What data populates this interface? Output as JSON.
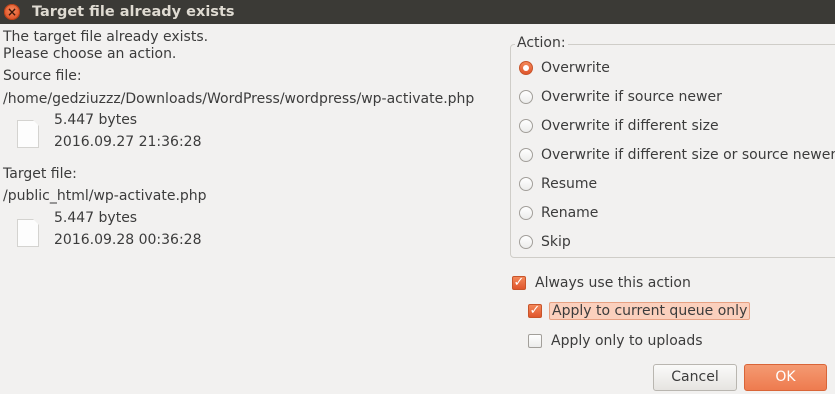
{
  "window": {
    "title": "Target file already exists",
    "close_glyph": "×"
  },
  "message": {
    "line1": "The target file already exists.",
    "line2": "Please choose an action."
  },
  "source": {
    "label": "Source file:",
    "path": "/home/gedziuzzz/Downloads/WordPress/wordpress/wp-activate.php",
    "size": "5.447 bytes",
    "date": "2016.09.27 21:36:28",
    "icon": "file-icon"
  },
  "target": {
    "label": "Target file:",
    "path": "/public_html/wp-activate.php",
    "size": "5.447 bytes",
    "date": "2016.09.28 00:36:28",
    "icon": "file-icon"
  },
  "action": {
    "legend": "Action:",
    "options": [
      {
        "label": "Overwrite",
        "checked": true
      },
      {
        "label": "Overwrite if source newer",
        "checked": false
      },
      {
        "label": "Overwrite if different size",
        "checked": false
      },
      {
        "label": "Overwrite if different size or source newer",
        "checked": false
      },
      {
        "label": "Resume",
        "checked": false
      },
      {
        "label": "Rename",
        "checked": false
      },
      {
        "label": "Skip",
        "checked": false
      }
    ]
  },
  "options": {
    "always_use": {
      "label": "Always use this action",
      "checked": true
    },
    "current_queue": {
      "label": "Apply to current queue only",
      "checked": true
    },
    "uploads_only": {
      "label": "Apply only to uploads",
      "checked": false
    }
  },
  "buttons": {
    "cancel": "Cancel",
    "ok": "OK"
  },
  "colors": {
    "accent": "#e9683a",
    "titlebar": "#3b3a36",
    "background": "#f2f1f0"
  }
}
